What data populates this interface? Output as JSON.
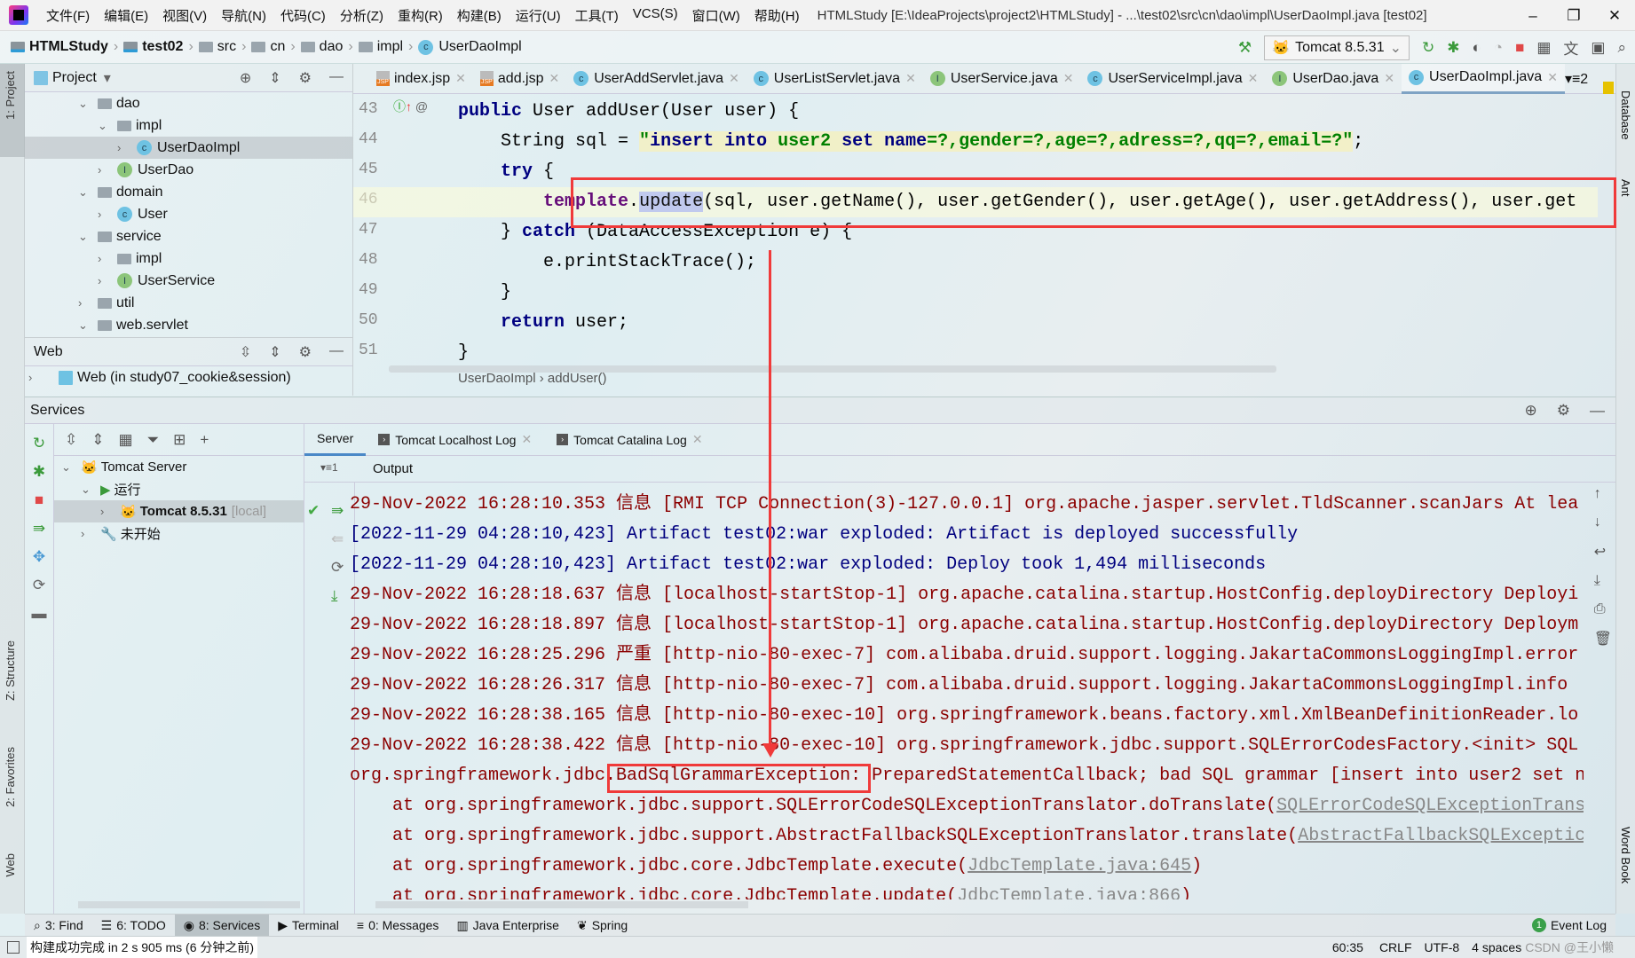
{
  "titlebar": {
    "menus": [
      "文件(F)",
      "编辑(E)",
      "视图(V)",
      "导航(N)",
      "代码(C)",
      "分析(Z)",
      "重构(R)",
      "构建(B)",
      "运行(U)",
      "工具(T)",
      "VCS(S)",
      "窗口(W)",
      "帮助(H)"
    ],
    "title": "HTMLStudy [E:\\IdeaProjects\\project2\\HTMLStudy] - ...\\test02\\src\\cn\\dao\\impl\\UserDaoImpl.java [test02]",
    "minimize": "–",
    "restore": "❐",
    "close": "✕"
  },
  "breadcrumb": [
    {
      "label": "HTMLStudy",
      "icon": "module-icon",
      "bold": true
    },
    {
      "label": "test02",
      "icon": "module-icon",
      "bold": true
    },
    {
      "label": "src",
      "icon": "folder-icon"
    },
    {
      "label": "cn",
      "icon": "folder-icon"
    },
    {
      "label": "dao",
      "icon": "folder-icon"
    },
    {
      "label": "impl",
      "icon": "folder-icon"
    },
    {
      "label": "UserDaoImpl",
      "icon": "class-icon"
    }
  ],
  "run_config": "Tomcat 8.5.31",
  "project_panel": {
    "title": "Project",
    "tree": [
      {
        "label": "dao",
        "icon": "folder",
        "depth": 3,
        "open": true
      },
      {
        "label": "impl",
        "icon": "folder",
        "depth": 4,
        "open": true
      },
      {
        "label": "UserDaoImpl",
        "icon": "class",
        "depth": 5,
        "selected": true
      },
      {
        "label": "UserDao",
        "icon": "interface",
        "depth": 4
      },
      {
        "label": "domain",
        "icon": "folder",
        "depth": 3,
        "open": true
      },
      {
        "label": "User",
        "icon": "class",
        "depth": 4
      },
      {
        "label": "service",
        "icon": "folder",
        "depth": 3,
        "open": true
      },
      {
        "label": "impl",
        "icon": "folder",
        "depth": 4
      },
      {
        "label": "UserService",
        "icon": "interface",
        "depth": 4
      },
      {
        "label": "util",
        "icon": "folder",
        "depth": 3
      },
      {
        "label": "web.servlet",
        "icon": "folder",
        "depth": 3,
        "open": true
      }
    ]
  },
  "web_panel": {
    "title": "Web",
    "item": "Web (in study07_cookie&session)"
  },
  "editor_tabs": [
    {
      "label": "index.jsp",
      "icon": "jsp"
    },
    {
      "label": "add.jsp",
      "icon": "jsp"
    },
    {
      "label": "UserAddServlet.java",
      "icon": "class"
    },
    {
      "label": "UserListServlet.java",
      "icon": "class"
    },
    {
      "label": "UserService.java",
      "icon": "interface"
    },
    {
      "label": "UserServiceImpl.java",
      "icon": "class"
    },
    {
      "label": "UserDao.java",
      "icon": "interface"
    },
    {
      "label": "UserDaoImpl.java",
      "icon": "class",
      "active": true
    }
  ],
  "tabs_overflow": "▾≡2",
  "code": [
    {
      "n": "43",
      "tokens": [
        [
          "    ",
          "plain"
        ],
        [
          "public ",
          "kw"
        ],
        [
          "User addUser(User user) {",
          "plain"
        ]
      ]
    },
    {
      "n": "44",
      "tokens": [
        [
          "        String sql = ",
          "plain"
        ],
        [
          "\"",
          "str"
        ],
        [
          "insert into ",
          "strk"
        ],
        [
          "user2 ",
          "str"
        ],
        [
          "set name",
          "strk"
        ],
        [
          "=?,gender=?,age=?,adress=?,qq=?,email=?\"",
          "str"
        ],
        [
          ";",
          "plain"
        ]
      ]
    },
    {
      "n": "45",
      "tokens": [
        [
          "        ",
          "plain"
        ],
        [
          "try ",
          "kw"
        ],
        [
          "{",
          "plain"
        ]
      ]
    },
    {
      "n": "46",
      "current": true,
      "tokens": [
        [
          "            ",
          "plain"
        ],
        [
          "template",
          "fld"
        ],
        [
          ".",
          "plain"
        ],
        [
          "update",
          "hl"
        ],
        [
          "(sql, user.getName(), user.getGender(), user.getAge(), user.getAddress(), user.get",
          "plain"
        ]
      ]
    },
    {
      "n": "47",
      "tokens": [
        [
          "        } ",
          "plain"
        ],
        [
          "catch ",
          "kw"
        ],
        [
          "(DataAccessException e) {",
          "plain"
        ]
      ]
    },
    {
      "n": "48",
      "tokens": [
        [
          "            e.printStackTrace();",
          "plain"
        ]
      ]
    },
    {
      "n": "49",
      "tokens": [
        [
          "        }",
          "plain"
        ]
      ]
    },
    {
      "n": "50",
      "tokens": [
        [
          "        ",
          "plain"
        ],
        [
          "return ",
          "kw"
        ],
        [
          "user;",
          "plain"
        ]
      ]
    },
    {
      "n": "51",
      "tokens": [
        [
          "    }",
          "plain"
        ]
      ]
    }
  ],
  "editor_breadcrumb": "UserDaoImpl  ›  addUser()",
  "right_stripe": {
    "database": "Database",
    "ant": "Ant",
    "wordbook": "Word Book"
  },
  "left_stripe": {
    "project": "1: Project",
    "structure": "Z: Structure",
    "favorites": "2: Favorites",
    "web": "Web"
  },
  "services": {
    "title": "Services",
    "tree": [
      {
        "label": "Tomcat Server",
        "depth": 0,
        "open": true
      },
      {
        "label": "运行",
        "depth": 1,
        "open": true,
        "icon": "run"
      },
      {
        "label": "Tomcat 8.5.31",
        "suffix": "[local]",
        "depth": 2,
        "selected": true
      },
      {
        "label": "未开始",
        "depth": 1,
        "icon": "wrench"
      }
    ],
    "tabs": [
      {
        "label": "Server",
        "active": true
      },
      {
        "label": "Tomcat Localhost Log",
        "closable": true
      },
      {
        "label": "Tomcat Catalina Log",
        "closable": true
      }
    ],
    "output_label": "Output",
    "output_count": "▾≡1"
  },
  "log": [
    [
      [
        "29-Nov-2022 16:28:10.353 信息 [RMI TCP Connection(3)-127.0.0.1] org.apache.jasper.servlet.TldScanner.scanJars At lea",
        "r"
      ]
    ],
    [
      [
        "[2022-11-29 04:28:10,423] Artifact test02:war exploded: Artifact is deployed successfully",
        "b"
      ]
    ],
    [
      [
        "[2022-11-29 04:28:10,423] Artifact test02:war exploded: Deploy took 1,494 milliseconds",
        "b"
      ]
    ],
    [
      [
        "29-Nov-2022 16:28:18.637 信息 [localhost-startStop-1] org.apache.catalina.startup.HostConfig.deployDirectory Deployi",
        "r"
      ]
    ],
    [
      [
        "29-Nov-2022 16:28:18.897 信息 [localhost-startStop-1] org.apache.catalina.startup.HostConfig.deployDirectory Deploym",
        "r"
      ]
    ],
    [
      [
        "29-Nov-2022 16:28:25.296 严重 [http-nio-80-exec-7] com.alibaba.druid.support.logging.JakartaCommonsLoggingImpl.error",
        "r"
      ]
    ],
    [
      [
        "29-Nov-2022 16:28:26.317 信息 [http-nio-80-exec-7] com.alibaba.druid.support.logging.JakartaCommonsLoggingImpl.info",
        "r"
      ]
    ],
    [
      [
        "29-Nov-2022 16:28:38.165 信息 [http-nio-80-exec-10] org.springframework.beans.factory.xml.XmlBeanDefinitionReader.lo",
        "r"
      ]
    ],
    [
      [
        "29-Nov-2022 16:28:38.422 信息 [http-nio-80-exec-10] org.springframework.jdbc.support.SQLErrorCodesFactory.<init> SQL",
        "r"
      ]
    ],
    [
      [
        "org.springframework.jdbc.BadSqlGrammarException: PreparedStatementCallback; bad SQL grammar [insert into user2 set n",
        "r"
      ]
    ],
    [
      [
        "    at org.springframework.jdbc.support.SQLErrorCodeSQLExceptionTranslator.doTranslate(",
        "r"
      ],
      [
        "SQLErrorCodeSQLExceptionTrans",
        "lk"
      ]
    ],
    [
      [
        "    at org.springframework.jdbc.support.AbstractFallbackSQLExceptionTranslator.translate(",
        "r"
      ],
      [
        "AbstractFallbackSQLExceptic",
        "lk"
      ]
    ],
    [
      [
        "    at org.springframework.jdbc.core.JdbcTemplate.execute(",
        "r"
      ],
      [
        "JdbcTemplate.java:645",
        "lk"
      ],
      [
        ")",
        "r"
      ]
    ],
    [
      [
        "    at org.springframework.jdbc.core.JdbcTemplate.update(",
        "r"
      ],
      [
        "JdbcTemplate.java:866",
        "lk"
      ],
      [
        ")",
        "r"
      ]
    ]
  ],
  "bottom_tools": [
    {
      "label": "3: Find",
      "icon": "search-icon"
    },
    {
      "label": "6: TODO",
      "icon": "list-icon"
    },
    {
      "label": "8: Services",
      "icon": "services-icon",
      "active": true
    },
    {
      "label": "Terminal",
      "icon": "terminal-icon"
    },
    {
      "label": "0: Messages",
      "icon": "messages-icon"
    },
    {
      "label": "Java Enterprise",
      "icon": "java-enterprise-icon"
    },
    {
      "label": "Spring",
      "icon": "spring-icon"
    }
  ],
  "event_log": {
    "label": "Event Log",
    "count": "1"
  },
  "status": {
    "message": "构建成功完成 in 2 s 905 ms (6 分钟之前)",
    "position": "60:35",
    "line_sep": "CRLF",
    "encoding": "UTF-8",
    "indent": "4 spaces"
  },
  "watermark": "CSDN @王小懒",
  "colors": {
    "annotation_red": "#f03a3a",
    "log_red": "#8b0000",
    "log_blue": "#00007f"
  }
}
